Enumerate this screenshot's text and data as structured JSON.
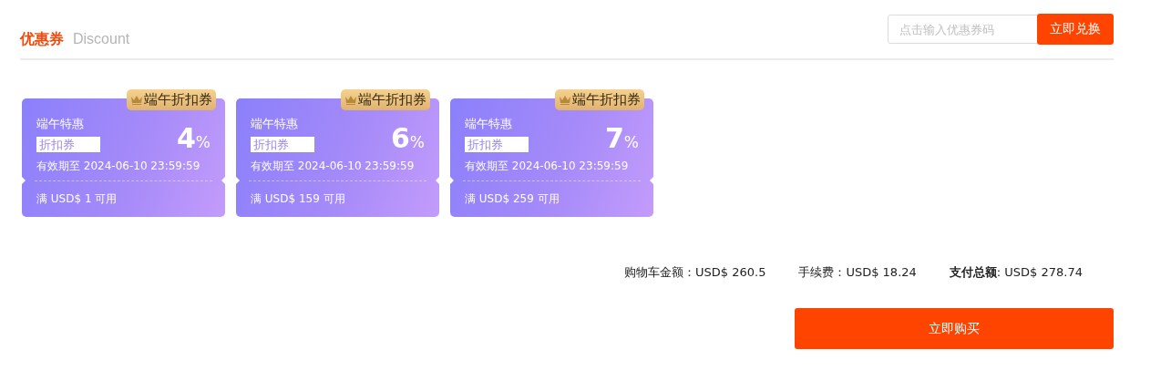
{
  "header": {
    "title": "优惠券",
    "subtitle": "Discount"
  },
  "redeem": {
    "placeholder": "点击输入优惠券码",
    "button": "立即兑换"
  },
  "coupons": [
    {
      "tag": "端午折扣券",
      "name": "端午特惠",
      "type": "折扣券",
      "discount": "4",
      "unit": "%",
      "validity": "有效期至 2024-06-10 23:59:59",
      "condition": "满 USD$ 1 可用"
    },
    {
      "tag": "端午折扣券",
      "name": "端午特惠",
      "type": "折扣券",
      "discount": "6",
      "unit": "%",
      "validity": "有效期至 2024-06-10 23:59:59",
      "condition": "满 USD$ 159 可用"
    },
    {
      "tag": "端午折扣券",
      "name": "端午特惠",
      "type": "折扣券",
      "discount": "7",
      "unit": "%",
      "validity": "有效期至 2024-06-10 23:59:59",
      "condition": "满 USD$ 259 可用"
    }
  ],
  "summary": [
    "购物车金额：USD$ 260.5",
    "手续费：USD$ 18.24",
    "**支付总额**: USD$ 278.74"
  ],
  "buy_button": "立即购买"
}
